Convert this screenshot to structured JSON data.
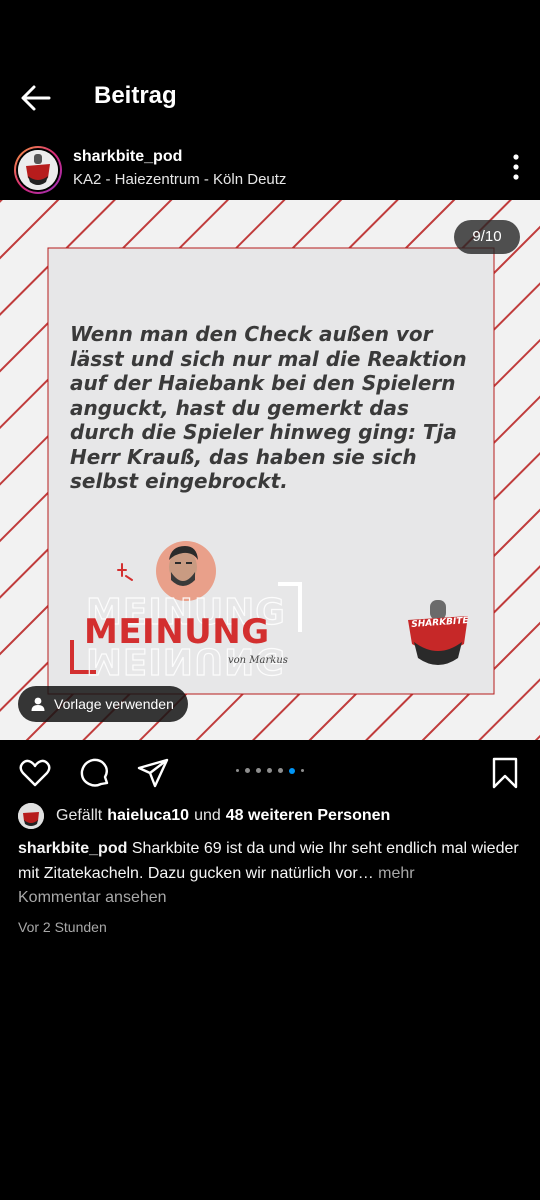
{
  "header": {
    "title": "Beitrag"
  },
  "post": {
    "username": "sharkbite_pod",
    "location": "KA2 - Haiezentrum - Köln Deutz",
    "slide_counter": "9/10",
    "image": {
      "quote": "Wenn man den Check außen vor lässt und sich nur mal die Reaktion auf der Haiebank bei den Spielern anguckt, hast du gemerkt das durch die Spieler hinweg ging: Tja Herr Krauß, das haben sie sich selbst eingebrockt.",
      "meinung_label": "MEINUNG",
      "byline": "von Markus",
      "logo_text": "SHARKBITE",
      "accent_color": "#d32f2f"
    },
    "template_button": "Vorlage verwenden",
    "carousel": {
      "total": 8,
      "active_index": 6
    },
    "likes": {
      "prefix": "Gefällt",
      "user": "haieluca10",
      "joiner": "und",
      "others": "48 weiteren Personen"
    },
    "caption": {
      "username": "sharkbite_pod",
      "text": "Sharkbite 69 ist da und wie Ihr seht endlich mal wieder mit Zitatekacheln. Dazu gucken wir natürlich vor…",
      "more": "mehr"
    },
    "comments_link": "Kommentar ansehen",
    "timestamp": "Vor 2 Stunden"
  }
}
